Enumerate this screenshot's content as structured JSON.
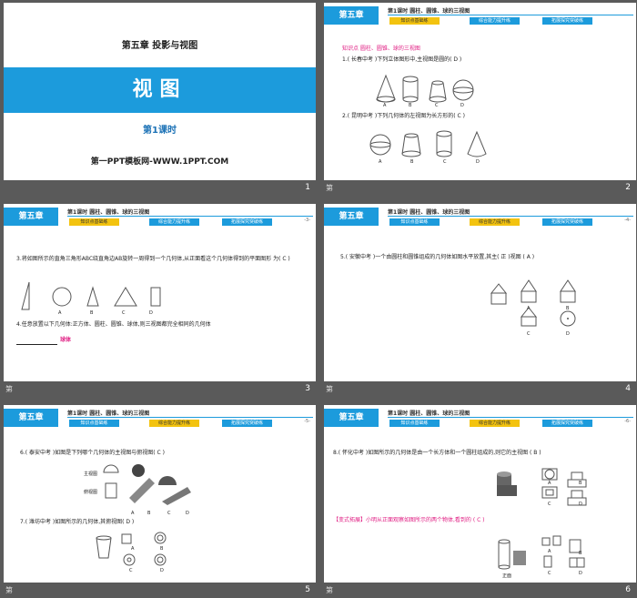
{
  "slides": [
    {
      "num": "1",
      "chapter": "第五章  投影与视图",
      "title": "视图",
      "lesson": "第1课时",
      "brand": "第一PPT模板网-WWW.1PPT.COM"
    },
    {
      "num": "2",
      "note": "第",
      "header": "第五章",
      "section": "第1课时  圆柱、圆锥、球的三视图",
      "tabs": [
        "知识点基础练",
        "综合能力提升练",
        "拓展探究突破练"
      ],
      "kp": "知识点      圆柱、圆锥、球的三视图",
      "q1": "1.(  长春中考  )下列立体图形中,主视图是圆的(  D  )",
      "q2": "2.(  昆明中考  )下列几何体的左视图为长方形的(  C  )",
      "labels": [
        "A",
        "B",
        "C",
        "D"
      ]
    },
    {
      "num": "3",
      "note": "第",
      "header": "第五章",
      "section": "第1课时  圆柱、圆锥、球的三视图",
      "tabs": [
        "知识点基础练",
        "综合能力提升练",
        "拓展探究突破练"
      ],
      "page": "-3-",
      "q3": "3.将如图所示的直角三角形ABC绕直角边AB旋转一周得到一个几何体,从正面看这个几何体得到的平面图形   为(  C  )",
      "q4": "4.任意放置以下几何体:正方体、圆柱、圆锥、球体,则三视图都完全相同的几何体",
      "q4_answer": "球体",
      "labels": [
        "A",
        "B",
        "C",
        "D"
      ]
    },
    {
      "num": "4",
      "note": "第",
      "header": "第五章",
      "section": "第1课时  圆柱、圆锥、球的三视图",
      "tabs": [
        "知识点基础练",
        "综合能力提升练",
        "拓展探究突破练"
      ],
      "page": "-4-",
      "q5": "5.(  安徽中考  )一个由圆柱和圆锥组成的几何体如图水平放置,其主(  正  )视图   (  A  )",
      "labels": [
        "A",
        "B",
        "C",
        "D"
      ]
    },
    {
      "num": "5",
      "note": "第",
      "header": "第五章",
      "section": "第1课时  圆柱、圆锥、球的三视图",
      "tabs": [
        "知识点基础练",
        "综合能力提升练",
        "拓展探究突破练"
      ],
      "page": "-5-",
      "q6": "6.(  泰安中考  )如图是下列哪个几何体的主视图与俯视图(  C  )",
      "q7": "7.(  潍坊中考  )如图所示的几何体,其俯视图(  D  )",
      "views": [
        "主视图",
        "俯视图"
      ],
      "labels": [
        "A",
        "B",
        "C",
        "D"
      ]
    },
    {
      "num": "6",
      "note": "第",
      "header": "第五章",
      "section": "第1课时  圆柱、圆锥、球的三视图",
      "tabs": [
        "知识点基础练",
        "综合能力提升练",
        "拓展探究突破练"
      ],
      "page": "-6-",
      "q8": "8.(  怀化中考  )如图所示的几何体是由一个长方体和一个圆柱组成的,则它的主视图   (  B  )",
      "ext": "【变式拓展】小明从正面观察如图所示的两个物体,看到的   (  C  )",
      "front": "正面",
      "labels": [
        "A",
        "B",
        "C",
        "D"
      ]
    }
  ],
  "colors": {
    "accent": "#1c9bdc",
    "tab_active": "#f3c30f",
    "answer": "#e01e83"
  }
}
